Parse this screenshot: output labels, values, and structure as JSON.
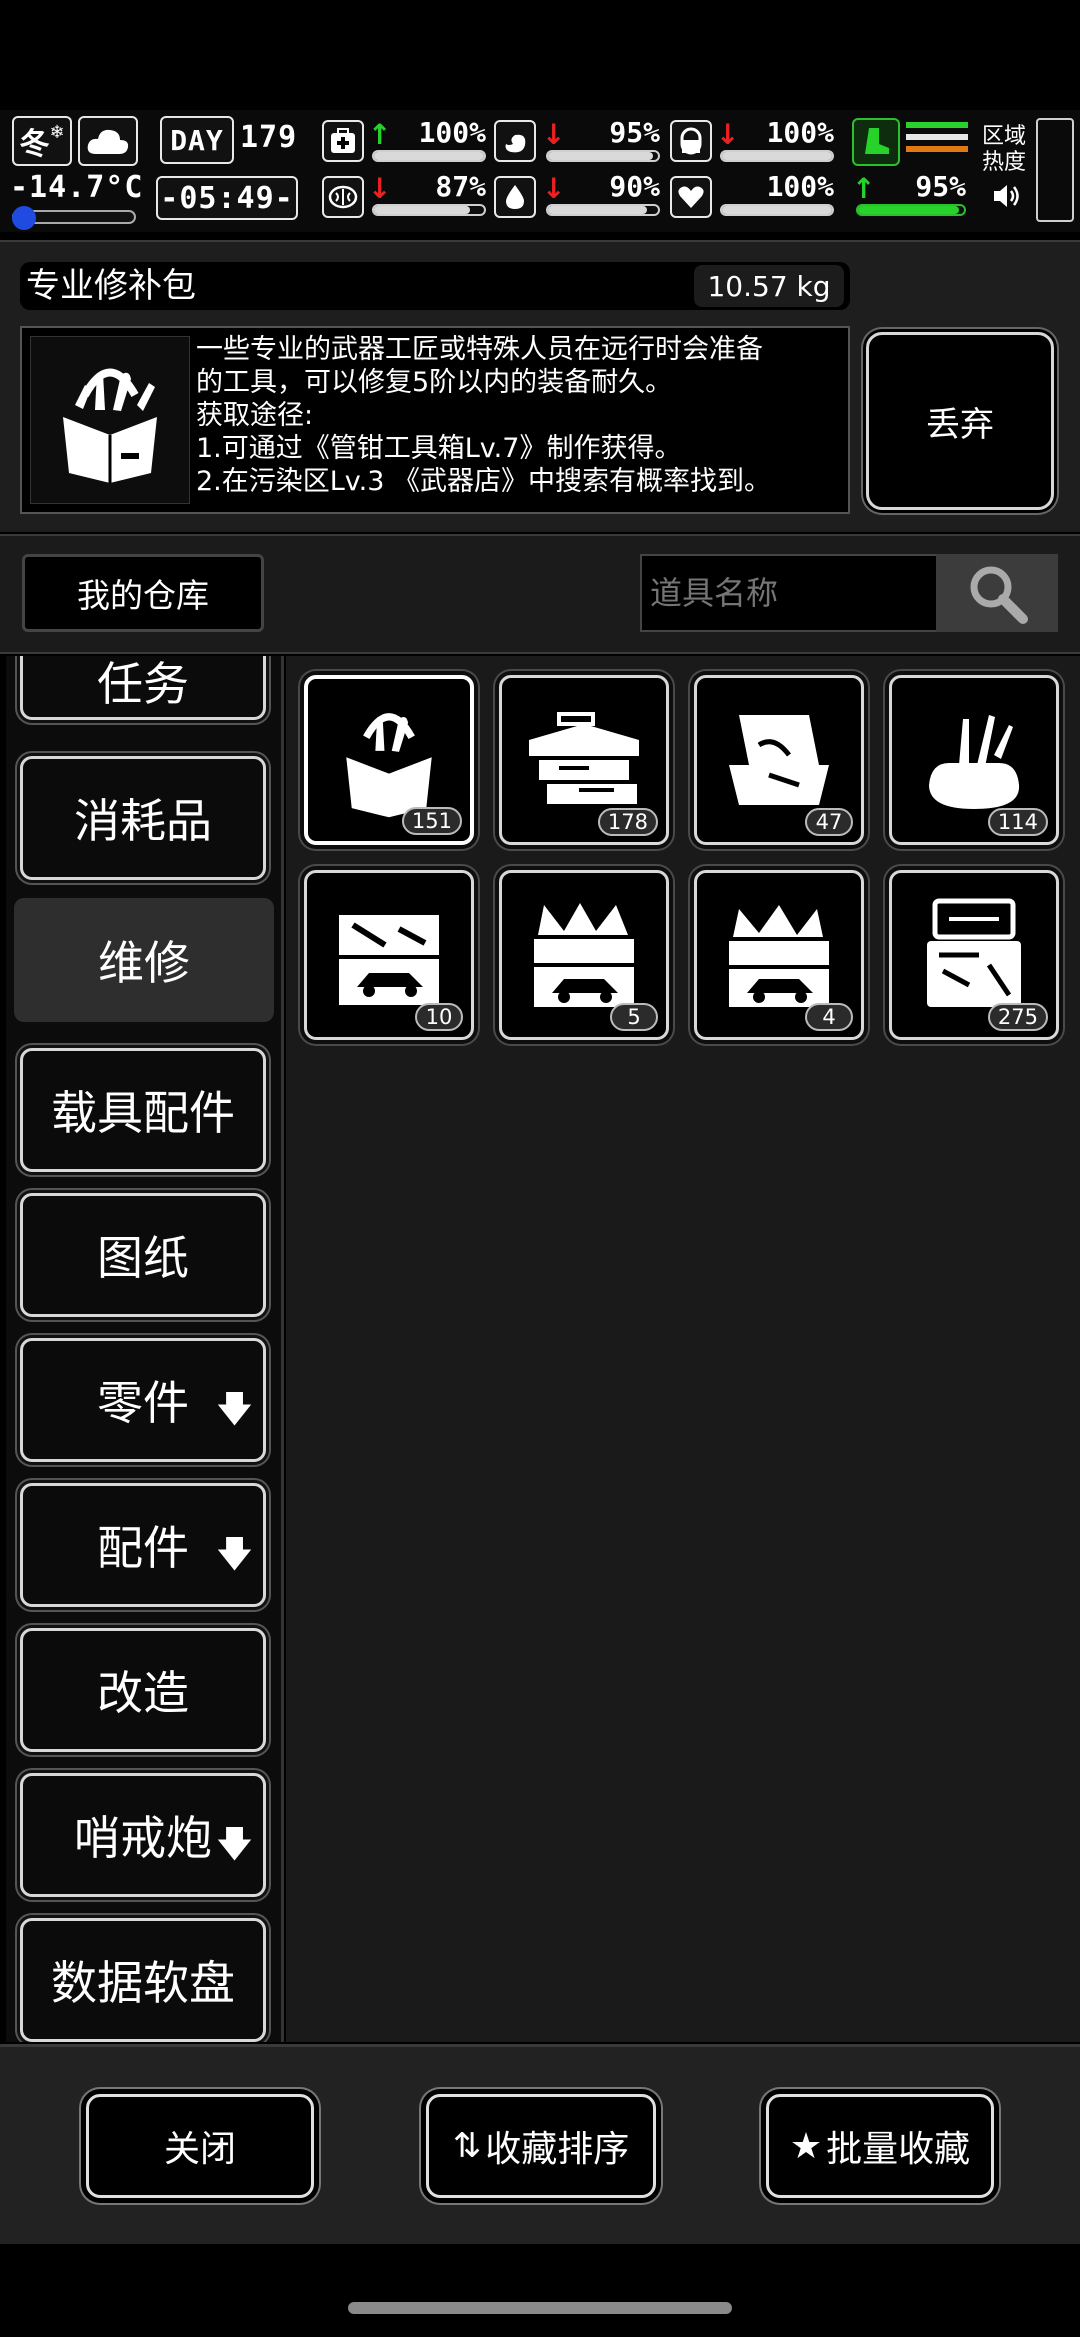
{
  "status": {
    "season": "冬",
    "temperature": "-14.7°C",
    "day_label": "DAY",
    "day_value": "179",
    "time": "-05:49-",
    "stats": [
      {
        "name": "health",
        "icon": "medkit-icon",
        "trend": "up",
        "value": "100%",
        "level": 1.0
      },
      {
        "name": "hunger",
        "icon": "stomach-icon",
        "trend": "down",
        "value": "95%",
        "level": 0.95
      },
      {
        "name": "fatigue",
        "icon": "pill-icon",
        "trend": "down",
        "value": "100%",
        "level": 1.0
      },
      {
        "name": "mental",
        "icon": "brain-icon",
        "trend": "down",
        "value": "87%",
        "level": 0.87
      },
      {
        "name": "thirst",
        "icon": "water-drop-icon",
        "trend": "down",
        "value": "90%",
        "level": 0.9
      },
      {
        "name": "mood",
        "icon": "heart-icon",
        "trend": "none",
        "value": "100%",
        "level": 1.0
      }
    ],
    "stamina": {
      "icon": "boot-icon",
      "trend": "up",
      "value": "95%",
      "level": 0.95
    },
    "region_heat_label_1": "区域",
    "region_heat_label_2": "热度"
  },
  "item": {
    "name": "专业修补包",
    "weight": "10.57 kg",
    "description": [
      "一些专业的武器工匠或特殊人员在远行时会准备",
      "的工具，可以修复5阶以内的装备耐久。",
      "获取途径:",
      "1.可通过《管钳工具箱Lv.7》制作获得。",
      "2.在污染区Lv.3 《武器店》中搜索有概率找到。"
    ],
    "discard_label": "丢弃"
  },
  "warehouse": {
    "button_label": "我的仓库",
    "search_placeholder": "道具名称"
  },
  "categories": [
    {
      "label": "任务",
      "active": false,
      "dropdown": false
    },
    {
      "label": "消耗品",
      "active": false,
      "dropdown": false
    },
    {
      "label": "维修",
      "active": true,
      "dropdown": false
    },
    {
      "label": "载具配件",
      "active": false,
      "dropdown": false
    },
    {
      "label": "图纸",
      "active": false,
      "dropdown": false
    },
    {
      "label": "零件",
      "active": false,
      "dropdown": true
    },
    {
      "label": "配件",
      "active": false,
      "dropdown": true
    },
    {
      "label": "改造",
      "active": false,
      "dropdown": false
    },
    {
      "label": "哨戒炮",
      "active": false,
      "dropdown": true
    },
    {
      "label": "数据软盘",
      "active": false,
      "dropdown": false
    }
  ],
  "items": [
    {
      "icon": "repair-bag-icon",
      "qty": "151",
      "selected": true
    },
    {
      "icon": "toolbox-icon",
      "qty": "178",
      "selected": false
    },
    {
      "icon": "tool-case-icon",
      "qty": "47",
      "selected": false
    },
    {
      "icon": "tool-pouch-icon",
      "qty": "114",
      "selected": false
    },
    {
      "icon": "car-toolbox-icon",
      "qty": "10",
      "selected": false
    },
    {
      "icon": "car-toolbox-full-icon",
      "qty": "5",
      "selected": false
    },
    {
      "icon": "car-toolbox-full-icon",
      "qty": "4",
      "selected": false
    },
    {
      "icon": "precision-kit-icon",
      "qty": "275",
      "selected": false
    }
  ],
  "bottom": {
    "close_label": "关闭",
    "sort_label": "收藏排序",
    "batch_label": "批量收藏"
  }
}
